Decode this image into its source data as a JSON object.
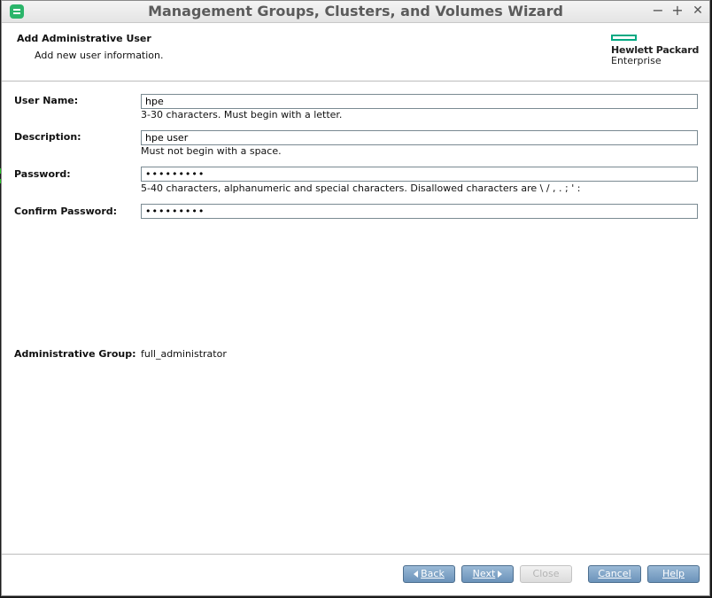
{
  "window": {
    "title": "Management Groups, Clusters, and Volumes Wizard",
    "app_icon": "storage-icon",
    "controls": {
      "minimize": "−",
      "maximize": "+",
      "close": "✕"
    }
  },
  "header": {
    "title": "Add Administrative User",
    "subtitle": "Add new user information.",
    "logo": {
      "line1": "Hewlett Packard",
      "line2": "Enterprise",
      "color": "#01a982"
    }
  },
  "form": {
    "user_name": {
      "label": "User Name:",
      "value": "hpe",
      "hint": "3-30 characters. Must begin with a letter."
    },
    "description": {
      "label": "Description:",
      "value": "hpe user",
      "hint": "Must not begin with a space."
    },
    "password": {
      "label": "Password:",
      "value": "•••••••••",
      "hint": "5-40 characters, alphanumeric and special characters. Disallowed characters are \\ / , . ; ' :"
    },
    "confirm_password": {
      "label": "Confirm Password:",
      "value": "•••••••••"
    },
    "admin_group": {
      "label": "Administrative Group:",
      "value": "full_administrator"
    }
  },
  "buttons": {
    "back": "Back",
    "next": "Next",
    "close": "Close",
    "cancel": "Cancel",
    "help": "Help"
  },
  "colors": {
    "button": "#7fa4c8",
    "accent": "#01a982"
  }
}
